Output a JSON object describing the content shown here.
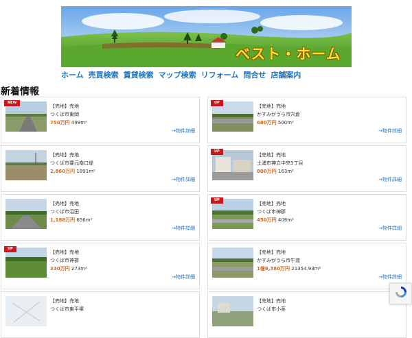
{
  "banner": {
    "title": "ベスト・ホーム"
  },
  "nav": {
    "items": [
      "ホーム",
      "売買検索",
      "賃貸検索",
      "マップ検索",
      "リフォーム",
      "問合せ",
      "店舗案内"
    ]
  },
  "section_title": "新着情報",
  "detail_link": "→物件詳細",
  "cards": [
    {
      "badge": "NEW",
      "type": "【売地】売地",
      "address": "つくば市東岡",
      "price": "750万円",
      "area": "499m²"
    },
    {
      "badge": "UP",
      "type": "【売地】売地",
      "address": "かすみがうら市宍倉",
      "price": "680万円",
      "area": "500m²"
    },
    {
      "badge": "",
      "type": "【売地】売地",
      "address": "つくば市要元南口堤",
      "price": "2,860万円",
      "area": "1891m²"
    },
    {
      "badge": "UP",
      "type": "【売地】売地",
      "address": "土浦市神立中央3丁目",
      "price": "800万円",
      "area": "163m²"
    },
    {
      "badge": "",
      "type": "【売地】売地",
      "address": "つくば市沼田",
      "price": "1,188万円",
      "area": "656m²"
    },
    {
      "badge": "UP",
      "type": "【売地】売地",
      "address": "つくば市神郡",
      "price": "450万円",
      "area": "408m²"
    },
    {
      "badge": "UP",
      "type": "【売地】売地",
      "address": "つくば市神郡",
      "price": "330万円",
      "area": "273m²"
    },
    {
      "badge": "",
      "type": "【売地】売地",
      "address": "かすみがうら市牛渡",
      "price": "1億9,380万円",
      "area": "21354.93m²"
    },
    {
      "badge": "",
      "type": "【売地】売地",
      "address": "つくば市東平塚",
      "price": "",
      "area": ""
    },
    {
      "badge": "",
      "type": "【売地】売地",
      "address": "つくば市小茎",
      "price": "",
      "area": ""
    }
  ]
}
